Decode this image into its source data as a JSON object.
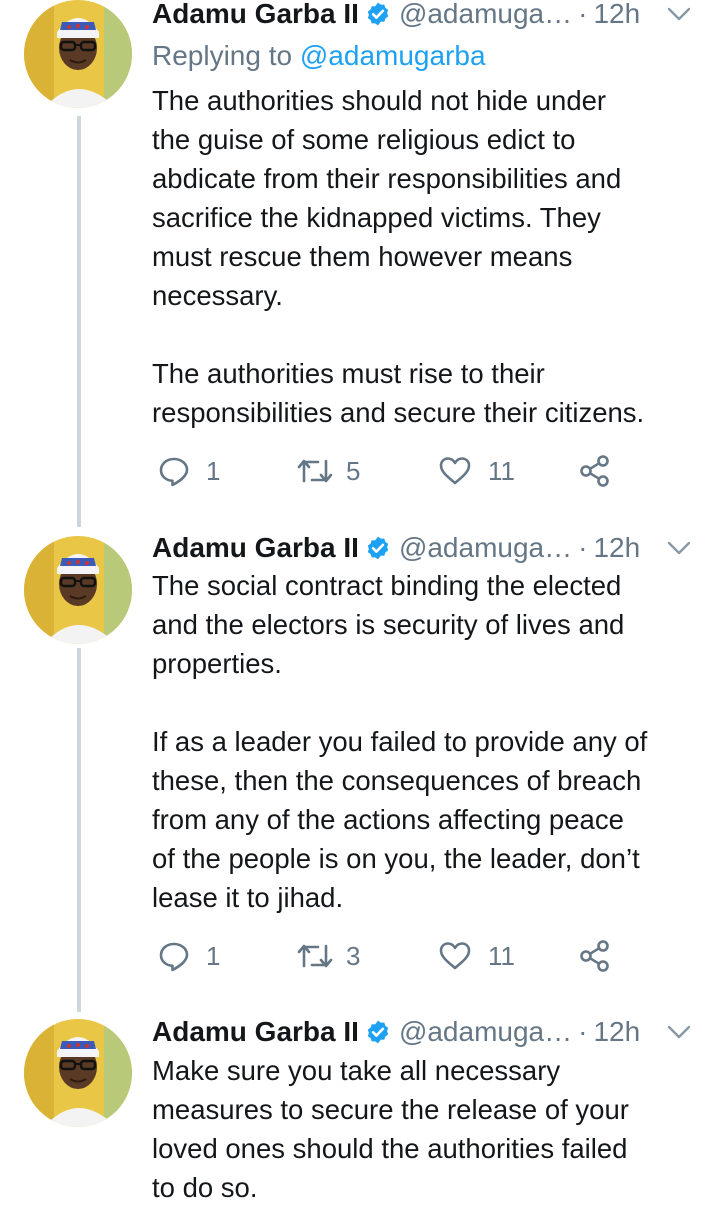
{
  "tweets": [
    {
      "name": "Adamu Garba II",
      "handle": "@adamuga…",
      "separator": "·",
      "time": "12h",
      "replying_prefix": "Replying to ",
      "replying_to": "@adamugarba",
      "paragraphs": [
        [
          "The authorities should not hide under",
          "the guise of some religious edict to",
          "abdicate from their responsibilities and",
          "sacrifice the kidnapped victims. They",
          "must rescue them however means",
          "necessary."
        ],
        [
          "The authorities must rise to their",
          "responsibilities and secure their citizens."
        ]
      ],
      "replies": "1",
      "retweets": "5",
      "likes": "11",
      "handle_full": "@adamuga…"
    },
    {
      "name": "Adamu Garba II",
      "handle": "@adamuga…",
      "separator": "·",
      "time": "12h",
      "paragraphs": [
        [
          "The social contract binding the elected",
          "and the electors is security of lives and",
          "properties."
        ],
        [
          "If as a leader you failed to provide any of",
          "these, then the consequences of breach",
          "from any of the actions affecting peace",
          "of the people is on you, the leader, don’t",
          "lease it to jihad."
        ]
      ],
      "replies": "1",
      "retweets": "3",
      "likes": "11"
    },
    {
      "name": "Adamu Garba II",
      "handle": "@adamuga…",
      "separator": "·",
      "time": "12h",
      "paragraphs": [
        [
          "Make sure you take all necessary",
          "measures to secure the release of your",
          "loved ones should the authorities failed",
          "to do so."
        ]
      ]
    }
  ],
  "colors": {
    "text": "#14171a",
    "secondary": "#657786",
    "accent": "#1da1f2",
    "thread_line": "#ccd6dd"
  },
  "icons": {
    "verified": "verified-badge-icon",
    "caret": "chevron-down-icon",
    "reply": "reply-icon",
    "retweet": "retweet-icon",
    "like": "heart-icon",
    "share": "share-icon"
  }
}
